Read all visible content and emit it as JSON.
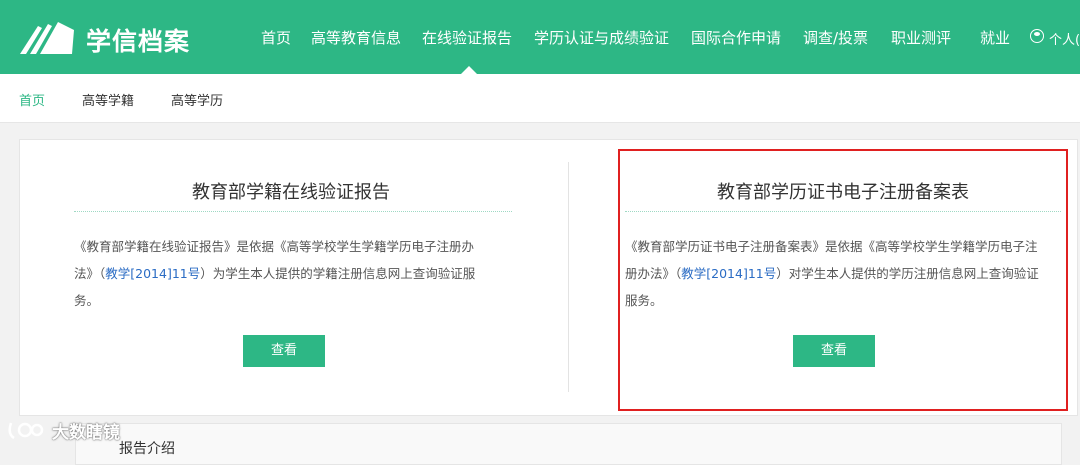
{
  "header": {
    "brand": "学信档案",
    "nav": [
      {
        "label": "首页"
      },
      {
        "label": "高等教育信息"
      },
      {
        "label": "在线验证报告"
      },
      {
        "label": "学历认证与成绩验证"
      },
      {
        "label": "国际合作申请"
      },
      {
        "label": "调查/投票"
      },
      {
        "label": "职业测评"
      },
      {
        "label": "就业"
      },
      {
        "label": "个人("
      }
    ],
    "user_icon": "user-icon"
  },
  "subnav": {
    "items": [
      {
        "label": "首页"
      },
      {
        "label": "高等学籍"
      },
      {
        "label": "高等学历"
      }
    ]
  },
  "panels": [
    {
      "title": "教育部学籍在线验证报告",
      "desc_lines": [
        {
          "a": "《教育部学籍在线验证报告》是依据《高等学校学生学籍学历电子注册办",
          "link": "",
          "b": ""
        },
        {
          "a": "法》（",
          "link": "教学[2014]11号",
          "b": "）为学生本人提供的学籍注册信息网上查询验证服"
        },
        {
          "a": "务。",
          "link": "",
          "b": ""
        }
      ],
      "button": "查看"
    },
    {
      "title": "教育部学历证书电子注册备案表",
      "desc_lines": [
        {
          "a": "《教育部学历证书电子注册备案表》是依据《高等学校学生学籍学历电子注",
          "link": "",
          "b": ""
        },
        {
          "a": "册办法》（",
          "link": "教学[2014]11号",
          "b": "）对学生本人提供的学历注册信息网上查询验证"
        },
        {
          "a": "服务。",
          "link": "",
          "b": ""
        }
      ],
      "button": "查看"
    }
  ],
  "bottom": {
    "title": "报告介绍"
  },
  "watermark": {
    "text": "大数瞎镜"
  },
  "colors": {
    "primary": "#2db785",
    "highlight": "#e02020",
    "link": "#2b6cc4"
  }
}
